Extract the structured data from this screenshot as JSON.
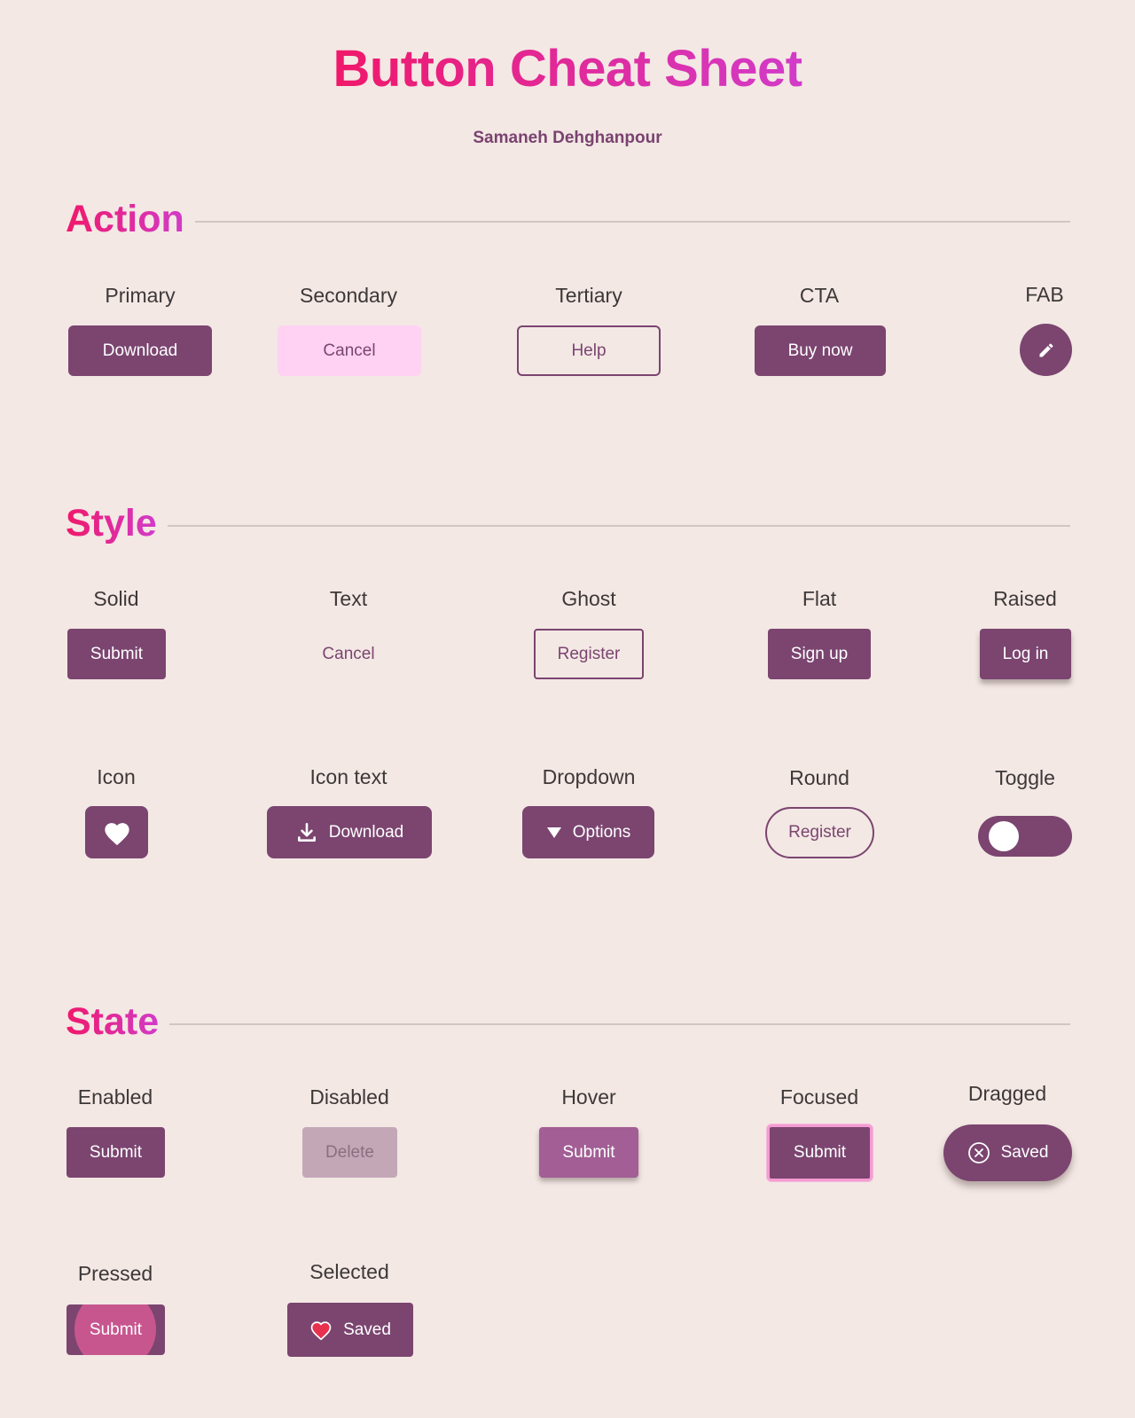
{
  "title": "Button Cheat Sheet",
  "author": "Samaneh Dehghanpour",
  "colors": {
    "background": "#f3e8e4",
    "accent_gradient_start": "#f0186a",
    "accent_gradient_end": "#d23bc9",
    "button": "#7b4570",
    "secondary_button": "#ffd2f3"
  },
  "sections": {
    "action": {
      "heading": "Action",
      "primary": {
        "label": "Primary",
        "button": "Download"
      },
      "secondary": {
        "label": "Secondary",
        "button": "Cancel"
      },
      "tertiary": {
        "label": "Tertiary",
        "button": "Help"
      },
      "cta": {
        "label": "CTA",
        "button": "Buy now"
      },
      "fab": {
        "label": "FAB",
        "icon": "pencil-icon"
      }
    },
    "style": {
      "heading": "Style",
      "solid": {
        "label": "Solid",
        "button": "Submit"
      },
      "text": {
        "label": "Text",
        "button": "Cancel"
      },
      "ghost": {
        "label": "Ghost",
        "button": "Register"
      },
      "flat": {
        "label": "Flat",
        "button": "Sign up"
      },
      "raised": {
        "label": "Raised",
        "button": "Log in"
      },
      "icon": {
        "label": "Icon",
        "icon": "heart-icon"
      },
      "icon_text": {
        "label": "Icon text",
        "button": "Download",
        "icon": "download-icon"
      },
      "dropdown": {
        "label": "Dropdown",
        "button": "Options",
        "icon": "caret-down-icon"
      },
      "round": {
        "label": "Round",
        "button": "Register"
      },
      "toggle": {
        "label": "Toggle",
        "state": "off"
      }
    },
    "state": {
      "heading": "State",
      "enabled": {
        "label": "Enabled",
        "button": "Submit"
      },
      "disabled": {
        "label": "Disabled",
        "button": "Delete"
      },
      "hover": {
        "label": "Hover",
        "button": "Submit"
      },
      "focused": {
        "label": "Focused",
        "button": "Submit"
      },
      "dragged": {
        "label": "Dragged",
        "button": "Saved",
        "icon": "close-circle-icon"
      },
      "pressed": {
        "label": "Pressed",
        "button": "Submit"
      },
      "selected": {
        "label": "Selected",
        "button": "Saved",
        "icon": "heart-icon"
      }
    }
  }
}
